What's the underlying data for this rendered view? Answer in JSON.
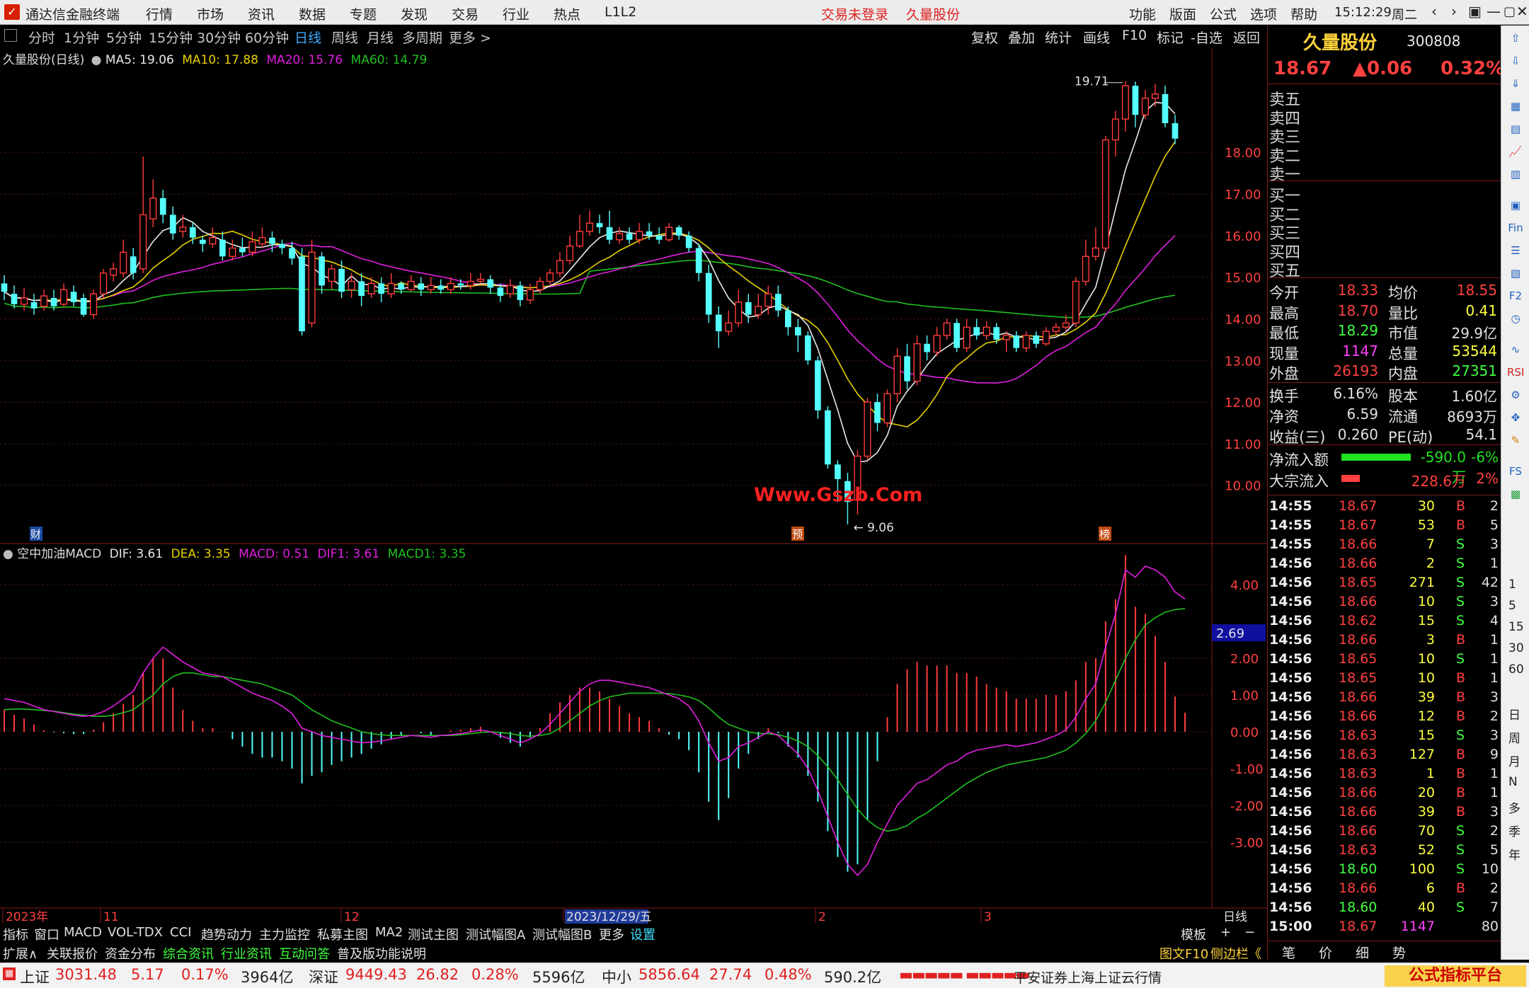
{
  "app": {
    "title": "通达信金融终端",
    "menus": [
      "行情",
      "市场",
      "资讯",
      "数据",
      "专题",
      "发现",
      "交易",
      "行业",
      "热点",
      "L1L2"
    ],
    "trade_status": "交易未登录",
    "stock_in_title": "久量股份",
    "right_menus": [
      "功能",
      "版面",
      "公式",
      "选项",
      "帮助"
    ],
    "time": "15:12:29",
    "weekday": "周二",
    "window_controls": [
      "‹",
      "›",
      "▣",
      "—",
      "▢",
      "✕"
    ]
  },
  "periods": [
    "分时",
    "1分钟",
    "5分钟",
    "15分钟",
    "30分钟",
    "60分钟",
    "日线",
    "周线",
    "月线",
    "多周期",
    "更多 >"
  ],
  "active_period": "日线",
  "chart_tools": [
    "复权",
    "叠加",
    "统计",
    "画线",
    "F10",
    "标记",
    "-自选",
    "返回"
  ],
  "main_legend": {
    "name": "久量股份(日线)",
    "ma5": "MA5: 19.06",
    "ma10": "MA10: 17.88",
    "ma20": "MA20: 15.76",
    "ma60": "MA60: 14.79"
  },
  "macd_legend": {
    "name": "空中加油MACD",
    "dif": "DIF: 3.61",
    "dea": "DEA: 3.35",
    "macd": "MACD: 0.51",
    "dif1": "DIF1: 3.61",
    "macd1": "MACD1: 3.35"
  },
  "price_axis": [
    "18.00",
    "17.00",
    "16.00",
    "15.00",
    "14.00",
    "13.00",
    "12.00",
    "11.00",
    "10.00"
  ],
  "macd_axis": [
    "4.00",
    "2.00",
    "1.00",
    "0.00",
    "-1.00",
    "-2.00",
    "-3.00"
  ],
  "macd_marker": "2.69",
  "high_label": "19.71",
  "low_label": "9.06",
  "event_tags": [
    "财",
    "预",
    "榜"
  ],
  "date_axis": [
    "2023年",
    "11",
    "12",
    "2023/12/29/五",
    "2",
    "3"
  ],
  "date_axis_right": "日线",
  "watermark_center": "Www.Gszb.Com",
  "colors": {
    "up": "#ff3b3b",
    "down": "#54ffff",
    "ma5": "#e8e8e8",
    "ma10": "#e8d000",
    "ma20": "#e020e0",
    "ma60": "#20c020"
  },
  "chart_data": {
    "type": "candlestick",
    "ylim": [
      8.6,
      20.3
    ],
    "candles": [
      [
        14.85,
        14.65,
        15.05,
        14.45
      ],
      [
        14.6,
        14.35,
        14.8,
        14.25
      ],
      [
        14.35,
        14.5,
        14.75,
        14.2
      ],
      [
        14.4,
        14.25,
        14.6,
        14.1
      ],
      [
        14.3,
        14.55,
        14.7,
        14.2
      ],
      [
        14.5,
        14.3,
        14.7,
        14.2
      ],
      [
        14.35,
        14.7,
        14.85,
        14.3
      ],
      [
        14.65,
        14.4,
        14.8,
        14.3
      ],
      [
        14.5,
        14.1,
        14.6,
        14.05
      ],
      [
        14.1,
        14.6,
        14.7,
        14.0
      ],
      [
        14.6,
        15.1,
        15.2,
        14.5
      ],
      [
        15.05,
        15.2,
        15.35,
        14.9
      ],
      [
        15.1,
        15.6,
        15.9,
        15.0
      ],
      [
        15.5,
        15.1,
        15.7,
        14.95
      ],
      [
        15.2,
        16.5,
        17.9,
        15.1
      ],
      [
        16.4,
        16.9,
        17.35,
        16.2
      ],
      [
        16.9,
        16.5,
        17.1,
        16.3
      ],
      [
        16.5,
        16.05,
        16.7,
        15.9
      ],
      [
        16.1,
        16.2,
        16.5,
        15.95
      ],
      [
        16.2,
        15.95,
        16.3,
        15.8
      ],
      [
        15.9,
        15.8,
        16.0,
        15.6
      ],
      [
        15.8,
        15.95,
        16.2,
        15.7
      ],
      [
        15.9,
        15.5,
        16.1,
        15.4
      ],
      [
        15.5,
        15.7,
        15.9,
        15.4
      ],
      [
        15.7,
        15.6,
        15.95,
        15.5
      ],
      [
        15.6,
        15.85,
        16.1,
        15.5
      ],
      [
        15.8,
        15.95,
        16.2,
        15.7
      ],
      [
        15.95,
        15.8,
        16.1,
        15.6
      ],
      [
        15.8,
        15.7,
        15.9,
        15.55
      ],
      [
        15.7,
        15.45,
        15.85,
        15.3
      ],
      [
        15.5,
        13.7,
        15.7,
        13.6
      ],
      [
        13.9,
        15.6,
        15.9,
        13.8
      ],
      [
        15.5,
        14.8,
        15.6,
        14.6
      ],
      [
        14.9,
        15.2,
        15.3,
        14.7
      ],
      [
        15.2,
        14.65,
        15.4,
        14.5
      ],
      [
        14.7,
        14.9,
        15.1,
        14.5
      ],
      [
        14.9,
        14.55,
        15.1,
        14.3
      ],
      [
        14.6,
        14.85,
        15.0,
        14.5
      ],
      [
        14.85,
        14.6,
        15.0,
        14.4
      ],
      [
        14.6,
        14.85,
        15.1,
        14.5
      ],
      [
        14.85,
        14.7,
        14.9,
        14.6
      ],
      [
        14.7,
        14.9,
        15.05,
        14.65
      ],
      [
        14.85,
        14.7,
        15.0,
        14.55
      ],
      [
        14.7,
        14.8,
        15.0,
        14.6
      ],
      [
        14.8,
        14.7,
        14.95,
        14.6
      ],
      [
        14.7,
        14.85,
        15.0,
        14.6
      ],
      [
        14.85,
        14.8,
        14.95,
        14.7
      ],
      [
        14.8,
        14.9,
        15.1,
        14.7
      ],
      [
        14.9,
        14.95,
        15.1,
        14.85
      ],
      [
        14.95,
        14.75,
        15.05,
        14.6
      ],
      [
        14.75,
        14.55,
        14.85,
        14.4
      ],
      [
        14.6,
        14.8,
        14.95,
        14.5
      ],
      [
        14.8,
        14.45,
        14.9,
        14.3
      ],
      [
        14.45,
        14.7,
        14.85,
        14.35
      ],
      [
        14.7,
        14.9,
        15.0,
        14.6
      ],
      [
        14.9,
        15.1,
        15.2,
        14.8
      ],
      [
        15.1,
        15.4,
        15.6,
        15.0
      ],
      [
        15.4,
        15.75,
        16.0,
        15.3
      ],
      [
        15.75,
        16.1,
        16.5,
        15.7
      ],
      [
        16.1,
        16.3,
        16.6,
        16.0
      ],
      [
        16.3,
        16.2,
        16.5,
        16.05
      ],
      [
        16.2,
        15.9,
        16.6,
        15.8
      ],
      [
        15.9,
        16.05,
        16.2,
        15.8
      ],
      [
        16.05,
        15.9,
        16.2,
        15.8
      ],
      [
        15.9,
        16.1,
        16.3,
        15.8
      ],
      [
        16.1,
        16.0,
        16.3,
        15.9
      ],
      [
        16.0,
        15.9,
        16.2,
        15.8
      ],
      [
        15.9,
        16.2,
        16.3,
        15.85
      ],
      [
        16.2,
        16.0,
        16.25,
        15.9
      ],
      [
        16.0,
        15.7,
        16.1,
        15.6
      ],
      [
        15.7,
        15.1,
        15.8,
        14.9
      ],
      [
        15.1,
        14.1,
        15.3,
        13.9
      ],
      [
        14.1,
        13.7,
        14.3,
        13.3
      ],
      [
        13.7,
        13.9,
        14.2,
        13.6
      ],
      [
        13.9,
        14.4,
        14.7,
        13.8
      ],
      [
        14.4,
        14.1,
        14.6,
        13.9
      ],
      [
        14.1,
        14.3,
        14.6,
        14.0
      ],
      [
        14.3,
        14.6,
        14.8,
        14.1
      ],
      [
        14.6,
        14.2,
        14.8,
        14.05
      ],
      [
        14.2,
        13.8,
        14.3,
        13.6
      ],
      [
        13.8,
        13.6,
        14.0,
        13.2
      ],
      [
        13.6,
        13.0,
        13.7,
        12.9
      ],
      [
        13.0,
        11.8,
        13.1,
        11.6
      ],
      [
        11.8,
        10.5,
        11.9,
        10.4
      ],
      [
        10.5,
        10.15,
        10.6,
        9.6
      ],
      [
        10.1,
        9.6,
        10.3,
        9.06
      ],
      [
        9.65,
        10.7,
        10.85,
        9.3
      ],
      [
        10.7,
        12.0,
        12.1,
        10.6
      ],
      [
        12.0,
        11.5,
        12.2,
        11.3
      ],
      [
        11.5,
        12.2,
        12.3,
        11.4
      ],
      [
        12.2,
        13.1,
        13.3,
        12.0
      ],
      [
        13.1,
        12.5,
        13.4,
        12.3
      ],
      [
        12.5,
        13.4,
        13.6,
        12.4
      ],
      [
        13.4,
        13.2,
        13.6,
        13.0
      ],
      [
        13.2,
        13.6,
        13.8,
        13.1
      ],
      [
        13.6,
        13.9,
        14.0,
        13.5
      ],
      [
        13.9,
        13.3,
        14.0,
        13.2
      ],
      [
        13.3,
        13.8,
        14.0,
        13.2
      ],
      [
        13.8,
        13.6,
        14.0,
        13.5
      ],
      [
        13.6,
        13.8,
        13.95,
        13.5
      ],
      [
        13.8,
        13.5,
        13.9,
        13.4
      ],
      [
        13.5,
        13.6,
        13.7,
        13.2
      ],
      [
        13.6,
        13.3,
        13.7,
        13.2
      ],
      [
        13.3,
        13.6,
        13.7,
        13.2
      ],
      [
        13.6,
        13.4,
        13.7,
        13.3
      ],
      [
        13.4,
        13.7,
        13.8,
        13.35
      ],
      [
        13.7,
        13.8,
        13.9,
        13.6
      ],
      [
        13.8,
        13.9,
        14.1,
        13.7
      ],
      [
        13.9,
        14.9,
        15.0,
        13.8
      ],
      [
        14.9,
        15.5,
        15.9,
        14.8
      ],
      [
        15.5,
        15.7,
        16.2,
        15.4
      ],
      [
        15.7,
        18.3,
        18.4,
        15.6
      ],
      [
        18.3,
        18.8,
        19.0,
        17.9
      ],
      [
        18.8,
        19.6,
        19.71,
        18.5
      ],
      [
        19.6,
        18.9,
        19.7,
        18.6
      ],
      [
        18.9,
        19.3,
        19.5,
        18.8
      ],
      [
        19.3,
        19.4,
        19.65,
        19.1
      ],
      [
        19.4,
        18.7,
        19.6,
        18.6
      ],
      [
        18.7,
        18.33,
        18.9,
        18.2
      ]
    ],
    "dif": [
      0.9,
      0.85,
      0.8,
      0.7,
      0.6,
      0.55,
      0.5,
      0.45,
      0.42,
      0.45,
      0.55,
      0.7,
      0.9,
      1.1,
      1.6,
      2.0,
      2.3,
      2.1,
      1.9,
      1.75,
      1.6,
      1.55,
      1.5,
      1.35,
      1.2,
      1.05,
      0.95,
      0.85,
      0.7,
      0.5,
      0.1,
      0.0,
      -0.1,
      -0.15,
      -0.2,
      -0.25,
      -0.3,
      -0.28,
      -0.25,
      -0.2,
      -0.15,
      -0.1,
      -0.12,
      -0.15,
      -0.1,
      -0.08,
      -0.05,
      0.0,
      0.05,
      0.0,
      -0.1,
      -0.2,
      -0.3,
      -0.2,
      -0.05,
      0.2,
      0.5,
      0.8,
      1.1,
      1.3,
      1.4,
      1.4,
      1.35,
      1.3,
      1.25,
      1.2,
      1.1,
      1.0,
      0.9,
      0.7,
      0.3,
      -0.3,
      -0.8,
      -0.7,
      -0.4,
      -0.3,
      -0.15,
      0.0,
      -0.1,
      -0.35,
      -0.6,
      -1.0,
      -1.6,
      -2.3,
      -3.0,
      -3.6,
      -3.9,
      -3.6,
      -3.0,
      -2.5,
      -2.0,
      -1.7,
      -1.4,
      -1.3,
      -1.1,
      -0.9,
      -0.8,
      -0.6,
      -0.5,
      -0.45,
      -0.4,
      -0.35,
      -0.4,
      -0.35,
      -0.3,
      -0.2,
      -0.1,
      0.05,
      0.4,
      0.9,
      1.3,
      2.3,
      3.2,
      4.4,
      4.2,
      4.5,
      4.4,
      4.2,
      3.8,
      3.61
    ],
    "dea": [
      0.6,
      0.62,
      0.62,
      0.6,
      0.58,
      0.56,
      0.52,
      0.48,
      0.45,
      0.42,
      0.42,
      0.45,
      0.52,
      0.6,
      0.8,
      1.0,
      1.3,
      1.5,
      1.6,
      1.6,
      1.55,
      1.5,
      1.5,
      1.45,
      1.4,
      1.35,
      1.3,
      1.2,
      1.1,
      1.0,
      0.8,
      0.6,
      0.45,
      0.3,
      0.2,
      0.1,
      0.0,
      -0.05,
      -0.08,
      -0.1,
      -0.1,
      -0.1,
      -0.1,
      -0.1,
      -0.1,
      -0.1,
      -0.08,
      -0.05,
      -0.02,
      0.0,
      -0.02,
      -0.05,
      -0.1,
      -0.12,
      -0.1,
      -0.05,
      0.1,
      0.3,
      0.5,
      0.7,
      0.85,
      0.95,
      1.0,
      1.05,
      1.05,
      1.05,
      1.05,
      1.04,
      1.0,
      0.95,
      0.85,
      0.65,
      0.4,
      0.2,
      0.1,
      0.0,
      -0.05,
      -0.05,
      -0.08,
      -0.15,
      -0.25,
      -0.4,
      -0.65,
      -0.95,
      -1.3,
      -1.7,
      -2.1,
      -2.4,
      -2.6,
      -2.7,
      -2.65,
      -2.55,
      -2.35,
      -2.2,
      -2.0,
      -1.8,
      -1.6,
      -1.4,
      -1.25,
      -1.1,
      -1.0,
      -0.9,
      -0.85,
      -0.8,
      -0.75,
      -0.7,
      -0.6,
      -0.5,
      -0.3,
      -0.05,
      0.3,
      0.8,
      1.4,
      2.0,
      2.5,
      2.9,
      3.1,
      3.25,
      3.32,
      3.35
    ]
  },
  "stock": {
    "name": "久量股份",
    "code": "300808",
    "price": "18.67",
    "change": "▲0.06",
    "pct": "0.32%"
  },
  "orderbook": [
    "卖五",
    "卖四",
    "卖三",
    "卖二",
    "卖一",
    "买一",
    "买二",
    "买三",
    "买四",
    "买五"
  ],
  "stats": [
    {
      "l1": "今开",
      "v1": "18.33",
      "c1": "#ff4040",
      "l2": "均价",
      "v2": "18.55",
      "c2": "#ff4040"
    },
    {
      "l1": "最高",
      "v1": "18.70",
      "c1": "#ff4040",
      "l2": "量比",
      "v2": "0.41",
      "c2": "#ffff40"
    },
    {
      "l1": "最低",
      "v1": "18.29",
      "c1": "#40ff40",
      "l2": "市值",
      "v2": "29.9亿",
      "c2": "#e0e0e0"
    },
    {
      "l1": "现量",
      "v1": "1147",
      "c1": "#ff40ff",
      "l2": "总量",
      "v2": "53544",
      "c2": "#ffff40"
    },
    {
      "l1": "外盘",
      "v1": "26193",
      "c1": "#ff4040",
      "l2": "内盘",
      "v2": "27351",
      "c2": "#40ff40"
    },
    {
      "l1": "换手",
      "v1": "6.16%",
      "c1": "#e0e0e0",
      "l2": "股本",
      "v2": "1.60亿",
      "c2": "#e0e0e0"
    },
    {
      "l1": "净资",
      "v1": "6.59",
      "c1": "#e0e0e0",
      "l2": "流通",
      "v2": "8693万",
      "c2": "#e0e0e0"
    },
    {
      "l1": "收益(三)",
      "v1": "0.260",
      "c1": "#e0e0e0",
      "l2": "PE(动)",
      "v2": "54.1",
      "c2": "#e0e0e0"
    }
  ],
  "flows": [
    {
      "label": "净流入额",
      "value": "-590.0万",
      "pct": "-6%",
      "bar": "#20e020",
      "bar_len": 0.82,
      "color": "#20e020"
    },
    {
      "label": "大宗流入",
      "value": "228.6万",
      "pct": "2%",
      "bar": "#ff4040",
      "bar_len": 0.22,
      "color": "#ff4040"
    }
  ],
  "ticks": [
    [
      "14:55",
      "18.67",
      "30",
      "B",
      "2"
    ],
    [
      "14:55",
      "18.67",
      "53",
      "B",
      "5"
    ],
    [
      "14:55",
      "18.66",
      "7",
      "S",
      "3"
    ],
    [
      "14:56",
      "18.66",
      "2",
      "S",
      "1"
    ],
    [
      "14:56",
      "18.65",
      "271",
      "S",
      "42"
    ],
    [
      "14:56",
      "18.66",
      "10",
      "S",
      "3"
    ],
    [
      "14:56",
      "18.62",
      "15",
      "S",
      "4"
    ],
    [
      "14:56",
      "18.66",
      "3",
      "B",
      "1"
    ],
    [
      "14:56",
      "18.65",
      "10",
      "S",
      "1"
    ],
    [
      "14:56",
      "18.65",
      "10",
      "B",
      "1"
    ],
    [
      "14:56",
      "18.66",
      "39",
      "B",
      "3"
    ],
    [
      "14:56",
      "18.66",
      "12",
      "B",
      "2"
    ],
    [
      "14:56",
      "18.63",
      "15",
      "S",
      "3"
    ],
    [
      "14:56",
      "18.63",
      "127",
      "B",
      "9"
    ],
    [
      "14:56",
      "18.63",
      "1",
      "B",
      "1"
    ],
    [
      "14:56",
      "18.66",
      "20",
      "B",
      "1"
    ],
    [
      "14:56",
      "18.66",
      "39",
      "B",
      "3"
    ],
    [
      "14:56",
      "18.66",
      "70",
      "S",
      "2"
    ],
    [
      "14:56",
      "18.63",
      "52",
      "S",
      "5"
    ],
    [
      "14:56",
      "18.60",
      "100",
      "S",
      "10"
    ],
    [
      "14:56",
      "18.66",
      "6",
      "B",
      "2"
    ],
    [
      "14:56",
      "18.60",
      "40",
      "S",
      "7"
    ],
    [
      "15:00",
      "18.67",
      "1147",
      "",
      ""
    ]
  ],
  "ticks_last_right": "80",
  "panel_tabs": [
    "笔",
    "价",
    "细",
    "势"
  ],
  "side_icons": [
    "1",
    "5",
    "15",
    "30",
    "60",
    "日",
    "周",
    "月",
    "N",
    "多",
    "季",
    "年"
  ],
  "bottom_tabs": [
    "指标",
    "窗口",
    "MACD",
    "VOL-TDX",
    "CCI",
    "趋势动力",
    "主力监控",
    "私募主图",
    "MA2",
    "测试主图",
    "测试幅图A",
    "测试幅图B",
    "更多",
    "设置"
  ],
  "bottom_tabs_right": [
    "模板",
    "+",
    "−"
  ],
  "bottom_tabs2": [
    "扩展∧",
    "关联报价",
    "资金分布",
    "综合资讯",
    "行业资讯",
    "互动问答",
    "普及版功能说明"
  ],
  "bottom_tabs2_right": [
    "图文F10",
    "侧边栏《"
  ],
  "status": {
    "sh_label": "上证",
    "sh_val": "3031.48",
    "sh_chg": "5.17",
    "sh_pct": "0.17%",
    "sh_amt": "3964亿",
    "sz_label": "深证",
    "sz_val": "9449.43",
    "sz_chg": "26.82",
    "sz_pct": "0.28%",
    "sz_amt": "5596亿",
    "zx_label": "中小",
    "zx_val": "5856.64",
    "zx_chg": "27.74",
    "zx_pct": "0.48%",
    "zx_amt": "590.2亿",
    "broker": "平安证券上海上证云行情"
  },
  "watermark_badge": "公式指标平台\nWww.Gszb.Com"
}
